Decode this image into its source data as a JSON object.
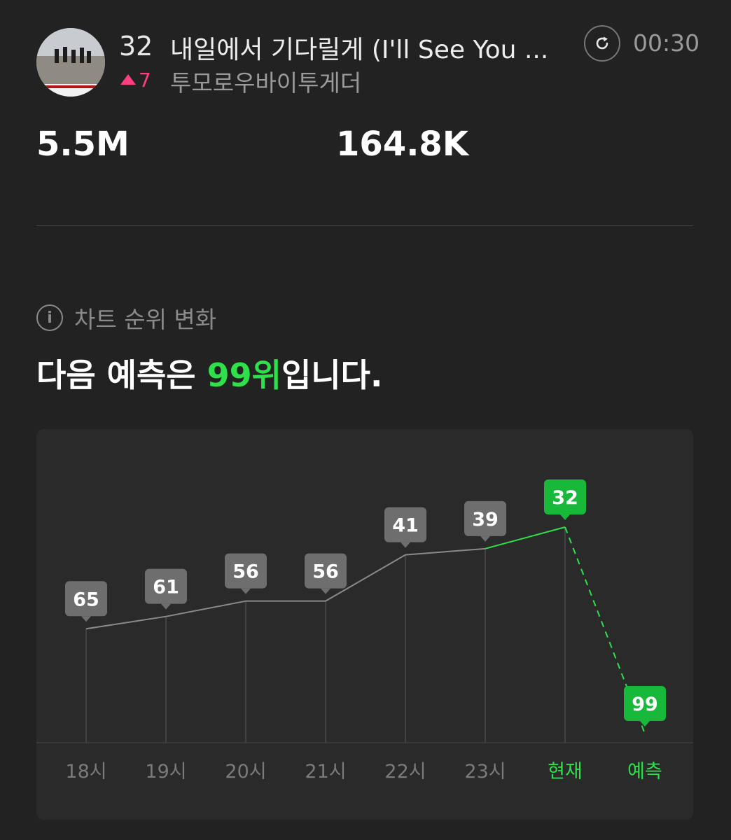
{
  "song": {
    "rank": "32",
    "title": "내일에서 기다릴게 (I'll See You ...",
    "rank_change": "7",
    "artist": "투모로우바이투게더"
  },
  "player": {
    "refresh_icon": "refresh-icon",
    "time": "00:30"
  },
  "stats": {
    "stat1": "5.5M",
    "stat2": "164.8K"
  },
  "section": {
    "info_icon": "info-icon",
    "label": "차트 순위 변화",
    "headline_prefix": "다음 예측은 ",
    "headline_highlight": "99위",
    "headline_suffix": "입니다."
  },
  "colors": {
    "background": "#222222",
    "panel": "#2a2a2a",
    "accent_green": "#2ee04a",
    "change_up": "#ff3f7f",
    "bubble_gray": "#6e6e6e"
  },
  "chart_data": {
    "type": "line",
    "categories": [
      "18시",
      "19시",
      "20시",
      "21시",
      "22시",
      "23시",
      "현재",
      "예측"
    ],
    "values": [
      65,
      61,
      56,
      56,
      41,
      39,
      32,
      99
    ],
    "y_inverted": true,
    "ylim": [
      99,
      32
    ],
    "highlight": [
      "현재",
      "예측"
    ],
    "predicted": [
      "예측"
    ],
    "grid": false
  }
}
